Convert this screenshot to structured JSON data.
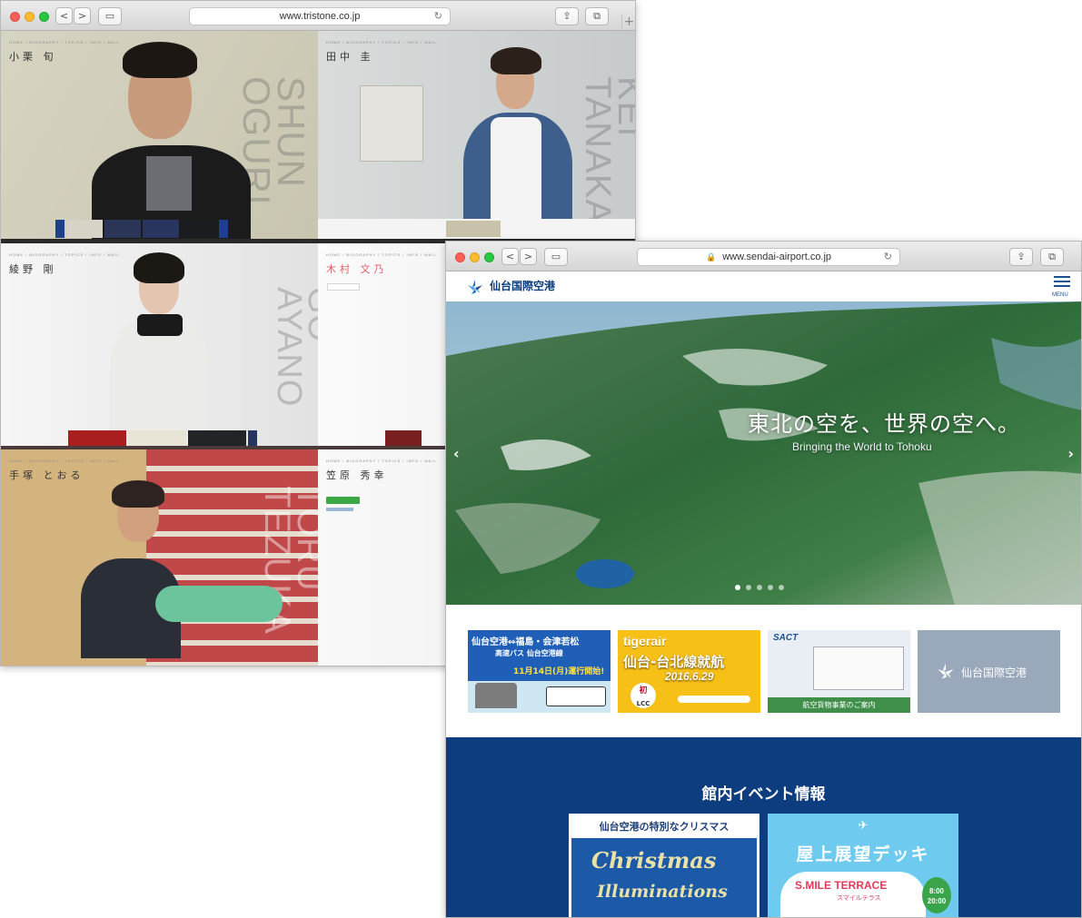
{
  "window1": {
    "url": "www.tristone.co.jp",
    "profiles": [
      {
        "name_jp": "小栗 旬",
        "name_en": "SHUN OGURI"
      },
      {
        "name_jp": "田中 圭",
        "name_en": "KEI TANAKA"
      },
      {
        "name_jp": "綾野 剛",
        "name_en": "GO AYANO"
      },
      {
        "name_jp": "木村 文乃",
        "name_en": ""
      },
      {
        "name_jp": "手塚 とおる",
        "name_en": "TORU TEZUKA"
      },
      {
        "name_jp": "笠原 秀幸",
        "name_en": ""
      }
    ]
  },
  "window2": {
    "url": "www.sendai-airport.co.jp",
    "logo_text": "仙台国際空港",
    "menu_label": "MENU",
    "hero": {
      "title": "東北の空を、世界の空へ。",
      "subtitle": "Bringing the World to Tohoku",
      "prev": "‹",
      "next": "›"
    },
    "banners": [
      {
        "title": "仙台空港⇔福島・会津若松",
        "line2": "高速バス 仙台空港線",
        "line3": "11月14日(月)運行開始!"
      },
      {
        "title": "tigerair",
        "line2": "仙台-台北線就航",
        "line3": "2016.6.29",
        "line4": "初",
        "line5": "LCC"
      },
      {
        "title": "SACT",
        "line2": "航空貨物事業のご案内"
      },
      {
        "title": "仙台国際空港"
      }
    ],
    "events": {
      "heading": "館内イベント情報",
      "card1": {
        "title": "仙台空港の特別なクリスマス",
        "line2": "Christmas",
        "line3": "Illuminations"
      },
      "card2": {
        "title": "屋上展望デッキ",
        "line2": "S.MILE TERRACE",
        "line3": "スマイルテラス",
        "time1": "8:00",
        "time2": "20:00"
      }
    }
  }
}
